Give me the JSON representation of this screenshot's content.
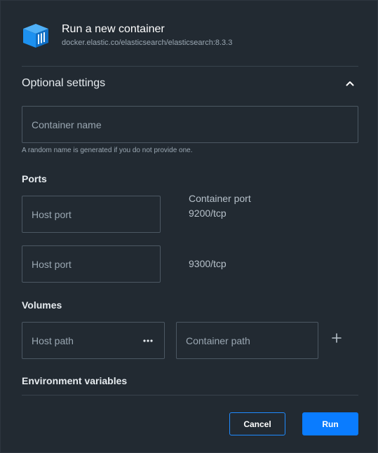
{
  "header": {
    "title": "Run a new container",
    "image_name": "docker.elastic.co/elasticsearch/elasticsearch:8.3.3",
    "icon": "container-icon"
  },
  "optional_settings": {
    "title": "Optional settings",
    "toggle_icon": "chevron-up-icon"
  },
  "container_name": {
    "placeholder": "Container name",
    "value": "",
    "helper": "A random name is generated if you do not provide one."
  },
  "ports": {
    "label": "Ports",
    "container_port_header": "Container port",
    "rows": [
      {
        "host_placeholder": "Host port",
        "container_port": "9200/tcp"
      },
      {
        "host_placeholder": "Host port",
        "container_port": "9300/tcp"
      }
    ]
  },
  "volumes": {
    "label": "Volumes",
    "host_path_placeholder": "Host path",
    "container_path_placeholder": "Container path",
    "browse_icon": "more-horizontal-icon",
    "add_icon": "plus-icon"
  },
  "environment": {
    "label": "Environment variables"
  },
  "footer": {
    "cancel_label": "Cancel",
    "run_label": "Run"
  },
  "colors": {
    "background": "#222a32",
    "accent": "#0a7cff",
    "border": "#4c5863",
    "icon_blue": "#1d91f0"
  }
}
